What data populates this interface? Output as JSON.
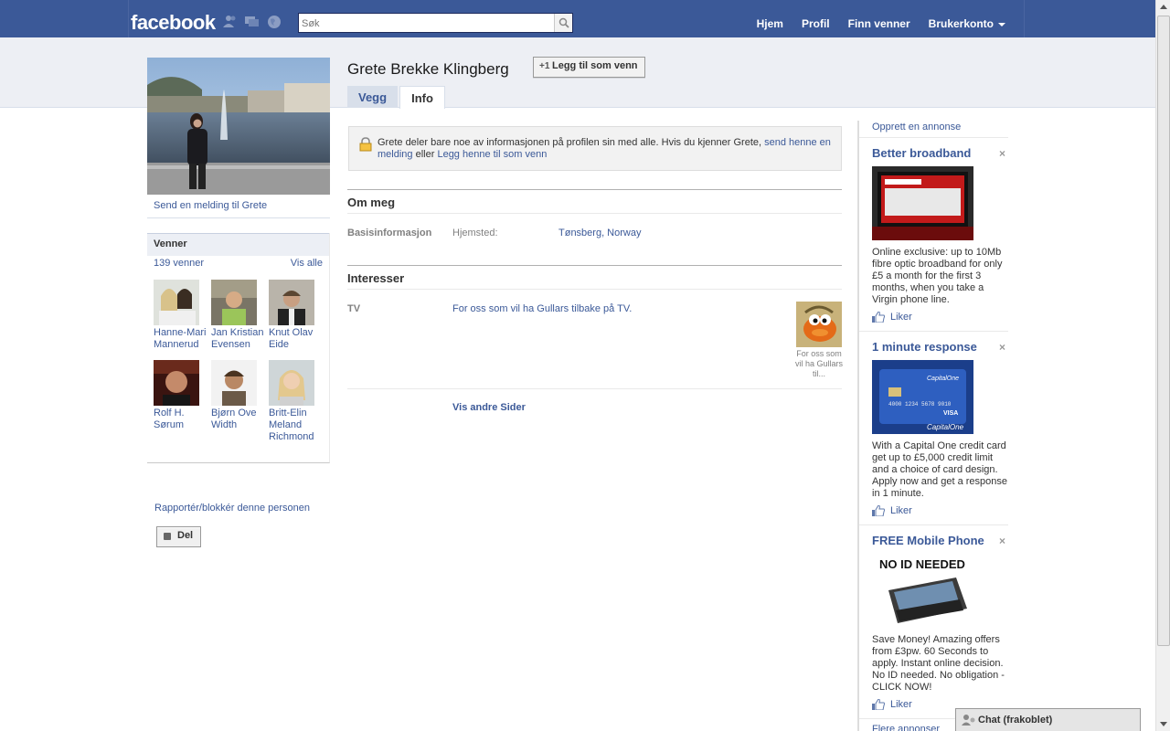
{
  "topbar": {
    "logo": "facebook",
    "search_placeholder": "Søk",
    "nav": [
      "Hjem",
      "Profil",
      "Finn venner",
      "Brukerkonto"
    ]
  },
  "profile": {
    "name": "Grete Brekke Klingberg",
    "add_friend_label": "Legg til som venn",
    "add_friend_icon": "+1",
    "send_message": "Send en melding til Grete",
    "tabs": [
      {
        "label": "Vegg",
        "active": false
      },
      {
        "label": "Info",
        "active": true
      }
    ]
  },
  "friends": {
    "title": "Venner",
    "count": "139 venner",
    "see_all": "Vis alle",
    "items": [
      {
        "name": "Hanne-Mari Mannerud"
      },
      {
        "name": "Jan Kristian Evensen"
      },
      {
        "name": "Knut Olav Eide"
      },
      {
        "name": "Rolf H. Sørum"
      },
      {
        "name": "Bjørn Ove Width"
      },
      {
        "name": "Britt-Elin Meland Richmond"
      }
    ]
  },
  "left_actions": {
    "report": "Rapportér/blokkér denne personen",
    "share": "Del"
  },
  "notice": {
    "text_prefix": "Grete deler bare noe av informasjonen på profilen sin med alle. Hvis du kjenner Grete,",
    "link1": "send henne en melding",
    "middle": "eller",
    "link2": "Legg henne til som venn"
  },
  "about": {
    "title": "Om meg",
    "section_label": "Basisinformasjon",
    "key": "Hjemsted:",
    "value": "Tønsberg, Norway"
  },
  "interests": {
    "title": "Interesser",
    "label": "TV",
    "value": "For oss som vil ha Gullars tilbake på TV.",
    "caption": "For oss som vil ha Gullars til...",
    "more": "Vis andre Sider"
  },
  "ads": {
    "create": "Opprett en annonse",
    "like_label": "Liker",
    "more": "Flere annonser",
    "items": [
      {
        "title": "Better broadband",
        "body": "Online exclusive: up to 10Mb fibre optic broadband for only £5 a month for the first 3 months, when you take a Virgin phone line."
      },
      {
        "title": "1 minute response",
        "body": "With a Capital One credit card get up to £5,000 credit limit and a choice of card design. Apply now and get a response in 1 minute."
      },
      {
        "title": "FREE Mobile Phone",
        "img_text": "NO ID NEEDED",
        "body": "Save Money! Amazing offers from £3pw. 60 Seconds to apply. Instant online decision. No ID needed. No obligation - CLICK NOW!"
      }
    ],
    "card_text": {
      "number": "4000 1234 5678 9010",
      "brand": "VISA",
      "bank": "CapitalOne"
    }
  },
  "chat": {
    "label": "Chat (frakoblet)"
  },
  "colors": {
    "brand": "#3b5998",
    "band": "#edeff4",
    "link": "#3b5998"
  }
}
